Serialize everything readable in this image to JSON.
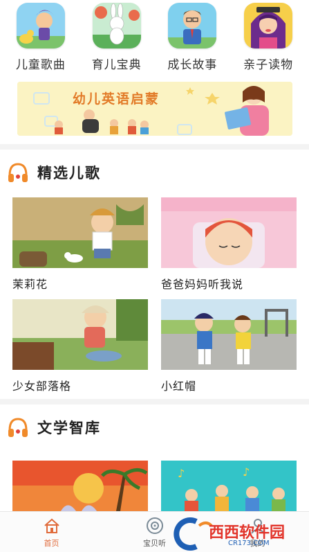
{
  "categories": [
    {
      "label": "儿童歌曲",
      "icon": "kid-singer-icon"
    },
    {
      "label": "育儿宝典",
      "icon": "bunny-icon"
    },
    {
      "label": "成长故事",
      "icon": "teacher-icon"
    },
    {
      "label": "亲子读物",
      "icon": "girl-reader-icon"
    }
  ],
  "banner": {
    "title": "幼儿英语启蒙"
  },
  "sections": [
    {
      "title": "精选儿歌"
    },
    {
      "title": "文学智库"
    }
  ],
  "songs": [
    {
      "caption": "茉莉花"
    },
    {
      "caption": "爸爸妈妈听我说"
    },
    {
      "caption": "少女部落格"
    },
    {
      "caption": "小红帽"
    }
  ],
  "tabs": [
    {
      "label": "首页",
      "icon": "home-icon",
      "active": true
    },
    {
      "label": "宝贝听",
      "icon": "listen-icon",
      "active": false
    },
    {
      "label": "我的",
      "icon": "profile-icon",
      "active": false
    }
  ],
  "watermark": {
    "brand": "西西软件园",
    "site": "CR173.COM"
  },
  "colors": {
    "accent": "#e06a3a",
    "banner_bg": "#fbf3c3",
    "divider": "#f3f3f3"
  }
}
